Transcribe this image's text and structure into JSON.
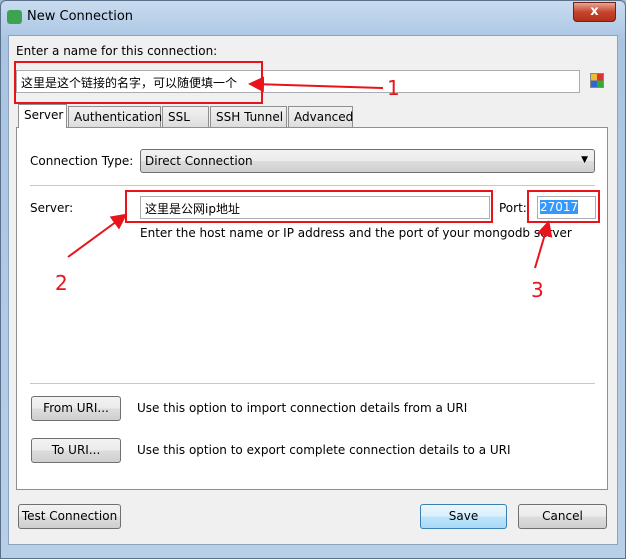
{
  "window": {
    "title": "New Connection",
    "close_label": "x"
  },
  "name_section": {
    "label": "Enter a name for this connection:",
    "value": "这里是这个链接的名字，可以随便填一个"
  },
  "tabs": [
    {
      "label": "Server",
      "active": true
    },
    {
      "label": "Authentication"
    },
    {
      "label": "SSL"
    },
    {
      "label": "SSH Tunnel"
    },
    {
      "label": "Advanced"
    }
  ],
  "server_tab": {
    "connection_type_label": "Connection Type:",
    "connection_type_value": "Direct Connection",
    "server_label": "Server:",
    "server_value": "这里是公网ip地址",
    "port_label": "Port:",
    "port_value": "27017",
    "hint": "Enter the host name or IP address and the port of your mongodb server",
    "from_uri_label": "From URI...",
    "from_uri_desc": "Use this option to import connection details from a URI",
    "to_uri_label": "To URI...",
    "to_uri_desc": "Use this option to export complete connection details to a URI"
  },
  "footer": {
    "test_label": "Test Connection",
    "save_label": "Save",
    "cancel_label": "Cancel"
  },
  "annotations": {
    "n1": "1",
    "n2": "2",
    "n3": "3",
    "color": "#e8131b"
  }
}
